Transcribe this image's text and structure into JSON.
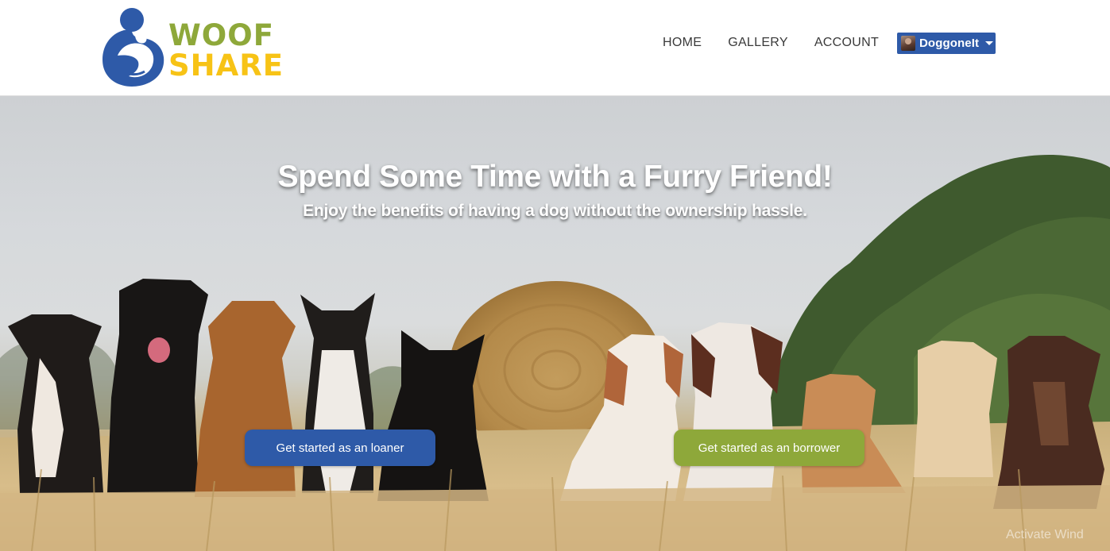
{
  "brand": {
    "line1": "WOOF",
    "line2": "SHARE",
    "colors": {
      "blue": "#2e5aa8",
      "green": "#8ea83a",
      "yellow": "#f7c316"
    }
  },
  "nav": {
    "links": [
      {
        "label": "HOME"
      },
      {
        "label": "GALLERY"
      },
      {
        "label": "ACCOUNT"
      }
    ],
    "user": {
      "name": "DoggoneIt",
      "avatar_icon": "user-avatar",
      "dropdown_icon": "caret-down-icon"
    }
  },
  "hero": {
    "title": "Spend Some Time with a Furry Friend!",
    "subtitle": "Enjoy the benefits of having a dog without the ownership hassle.",
    "background_image": "dogs-in-wheat-field",
    "cta_loaner": "Get started as an loaner",
    "cta_borrower": "Get started as an borrower"
  },
  "watermark": "Activate Wind"
}
